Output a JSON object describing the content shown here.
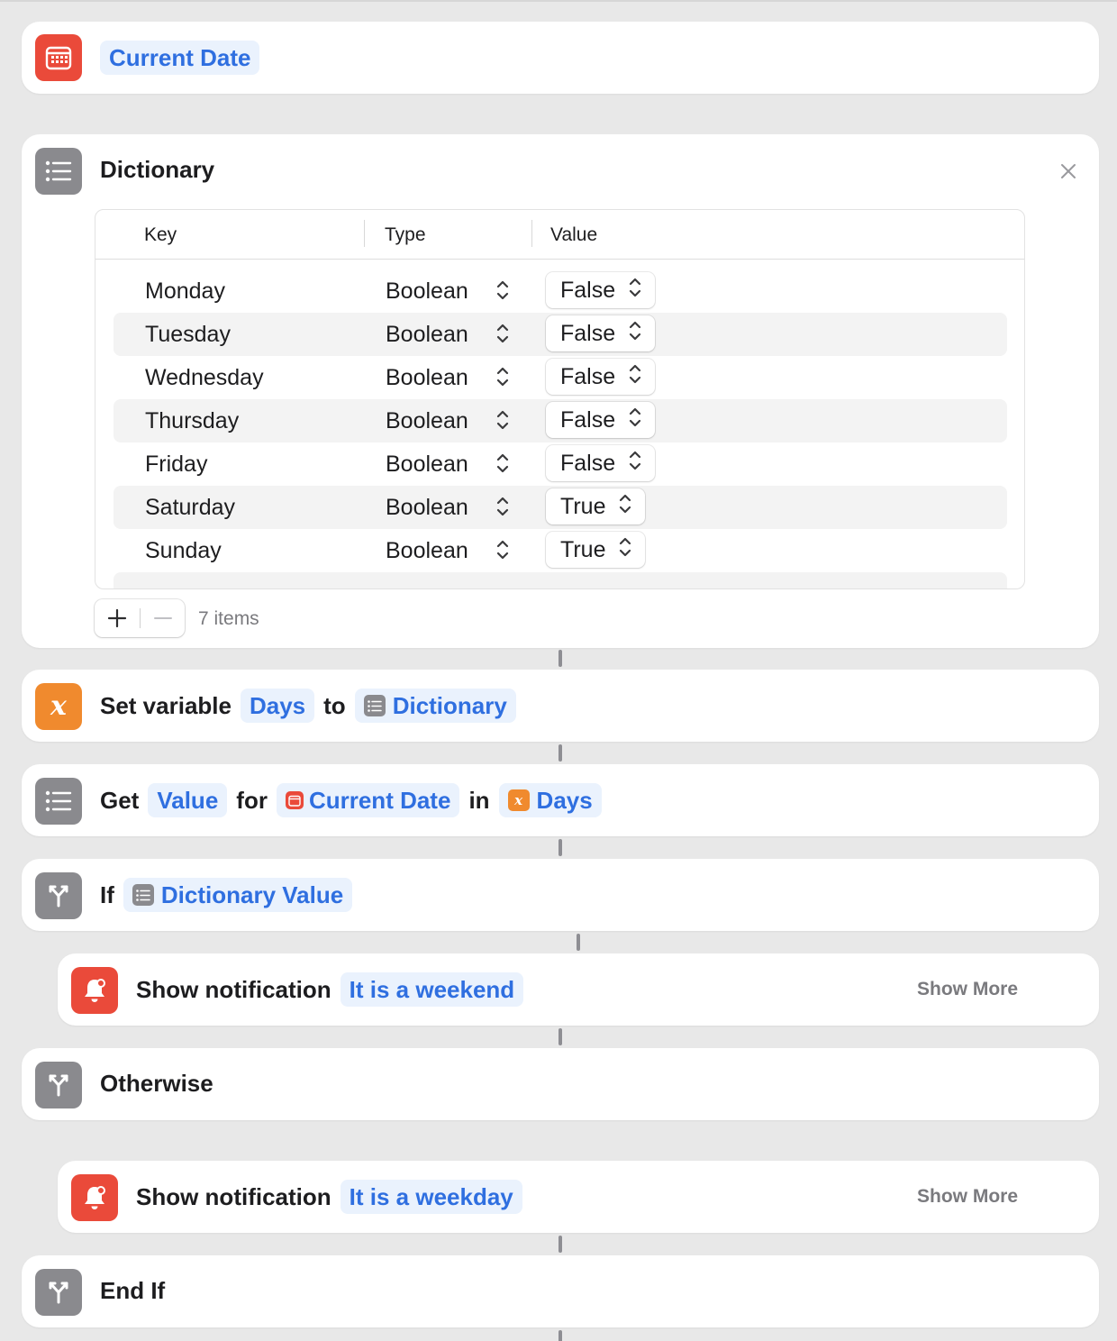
{
  "current_date_action": {
    "token": "Current Date"
  },
  "dictionary_action": {
    "title": "Dictionary",
    "headers": {
      "key": "Key",
      "type": "Type",
      "value": "Value"
    },
    "rows": [
      {
        "key": "Monday",
        "type": "Boolean",
        "value": "False"
      },
      {
        "key": "Tuesday",
        "type": "Boolean",
        "value": "False"
      },
      {
        "key": "Wednesday",
        "type": "Boolean",
        "value": "False"
      },
      {
        "key": "Thursday",
        "type": "Boolean",
        "value": "False"
      },
      {
        "key": "Friday",
        "type": "Boolean",
        "value": "False"
      },
      {
        "key": "Saturday",
        "type": "Boolean",
        "value": "True"
      },
      {
        "key": "Sunday",
        "type": "Boolean",
        "value": "True"
      }
    ],
    "count_label": "7 items"
  },
  "set_variable_action": {
    "verb": "Set variable",
    "variable": "Days",
    "to": "to",
    "value": "Dictionary"
  },
  "get_value_action": {
    "verb": "Get",
    "what": "Value",
    "for": "for",
    "key": "Current Date",
    "in": "in",
    "source": "Days"
  },
  "if_action": {
    "verb": "If",
    "condition": "Dictionary Value"
  },
  "notification_weekend": {
    "verb": "Show notification",
    "message": "It is a weekend",
    "show_more": "Show More"
  },
  "otherwise_action": {
    "verb": "Otherwise"
  },
  "notification_weekday": {
    "verb": "Show notification",
    "message": "It is a weekday",
    "show_more": "Show More"
  },
  "end_if_action": {
    "verb": "End If"
  },
  "colors": {
    "accent": "#2f6fe0",
    "token_bg": "#eaf2fd",
    "red_icon": "#ea4a3a",
    "gray_icon": "#8a8a8e",
    "orange_icon": "#f08a2e"
  }
}
